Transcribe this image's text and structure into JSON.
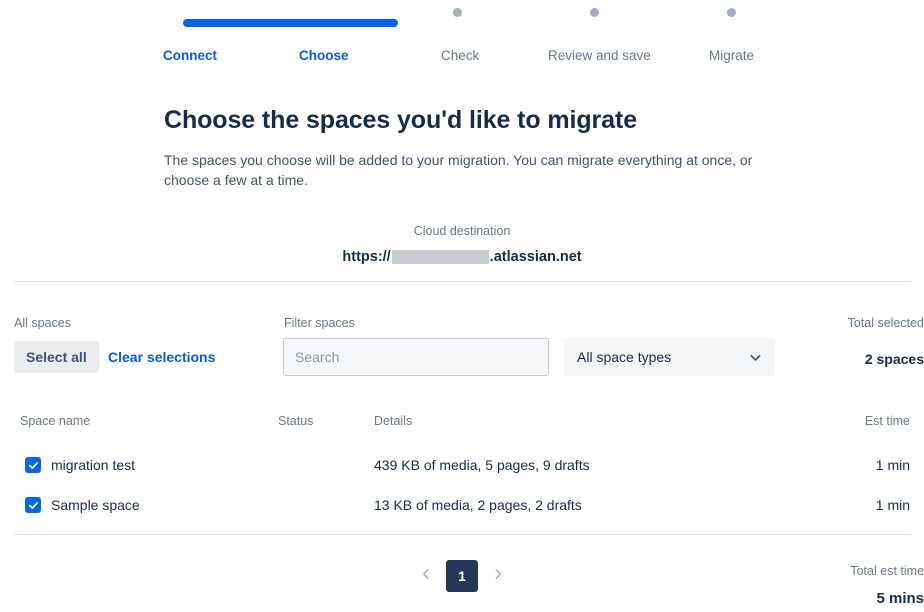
{
  "stepper": {
    "steps": [
      {
        "label": "Connect",
        "state": "active"
      },
      {
        "label": "Choose",
        "state": "active"
      },
      {
        "label": "Check",
        "state": "inactive"
      },
      {
        "label": "Review and save",
        "state": "inactive"
      },
      {
        "label": "Migrate",
        "state": "inactive"
      }
    ],
    "progress_color": "#0a63f0",
    "dot_color": "#a5adba"
  },
  "main": {
    "heading": "Choose the spaces you'd like to migrate",
    "subtext": "The spaces you choose will be added to your migration. You can migrate everything at once, or choose a few at a time."
  },
  "destination": {
    "label": "Cloud destination",
    "url_prefix": "https://",
    "url_redacted": "",
    "url_suffix": ".atlassian.net"
  },
  "toolbar": {
    "all_spaces_label": "All spaces",
    "select_all_label": "Select all",
    "clear_selections_label": "Clear selections",
    "filter_spaces_label": "Filter spaces",
    "search_placeholder": "Search",
    "search_value": "",
    "space_type_selected": "All space types",
    "space_type_options": [
      "All space types"
    ],
    "total_selected_label": "Total selected",
    "total_selected_value": "2 spaces"
  },
  "table": {
    "columns": [
      "Space name",
      "Status",
      "Details",
      "Est time"
    ],
    "rows": [
      {
        "checked": true,
        "name": "migration test",
        "status": "",
        "details": "439 KB of media, 5 pages, 9 drafts",
        "est_time": "1 min"
      },
      {
        "checked": true,
        "name": "Sample space",
        "status": "",
        "details": "13 KB of media, 2 pages, 2 drafts",
        "est_time": "1 min"
      }
    ]
  },
  "pagination": {
    "prev_icon": "chevron-left-icon",
    "next_icon": "chevron-right-icon",
    "current_page": "1"
  },
  "footer": {
    "total_est_time_label": "Total est time",
    "total_est_time_value": "5 mins"
  },
  "colors": {
    "accent_blue": "#0a5ae0",
    "checkbox_blue": "#0c66e4",
    "pager_navy": "#253858",
    "text_primary": "#172b4d",
    "text_muted": "#6b778c",
    "divider": "#dfe1e6"
  }
}
